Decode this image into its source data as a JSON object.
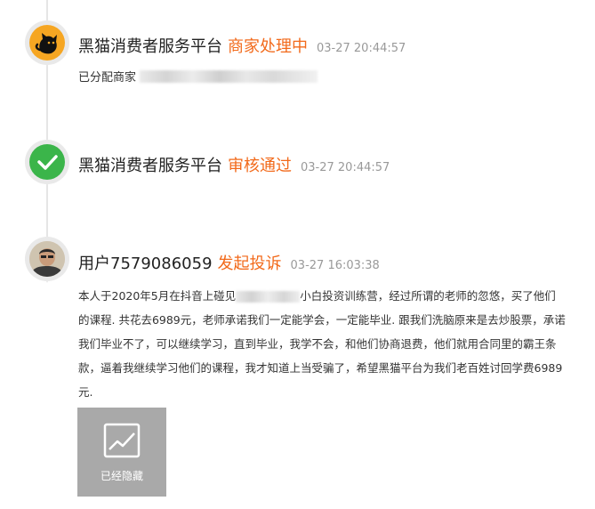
{
  "entries": [
    {
      "name": "黑猫消费者服务平台",
      "action": "商家处理中",
      "time": "03-27 20:44:57",
      "detail_label": "已分配商家"
    },
    {
      "name": "黑猫消费者服务平台",
      "action": "审核通过",
      "time": "03-27 20:44:57"
    },
    {
      "name": "用户7579086059",
      "action": "发起投诉",
      "time": "03-27 16:03:38",
      "complaint_part1": "本人于2020年5月在抖音上碰见",
      "complaint_part2": "小白投资训练营，经过所谓的老师的忽悠，买了他们的课程. 共花去6989元，老师承诺我们一定能学会，一定能毕业. 跟我们洗脑原来是去炒股票，承诺我们毕业不了，可以继续学习，直到毕业，我学不会，和他们协商退费，他们就用合同里的霸王条款，逼着我继续学习他们的课程，我才知道上当受骗了，希望黑猫平台为我们老百姓讨回学费6989元.",
      "attachment_label": "已经隐藏"
    }
  ],
  "colors": {
    "action": "#f26a1b",
    "check_badge": "#3bb54a",
    "timeline": "#e6e6e6",
    "hidden_tile": "#a9a9a9"
  },
  "icons": {
    "entry0": "black-cat-logo-icon",
    "entry1": "check-icon",
    "entry2": "user-avatar",
    "attachment": "image-placeholder-icon"
  }
}
